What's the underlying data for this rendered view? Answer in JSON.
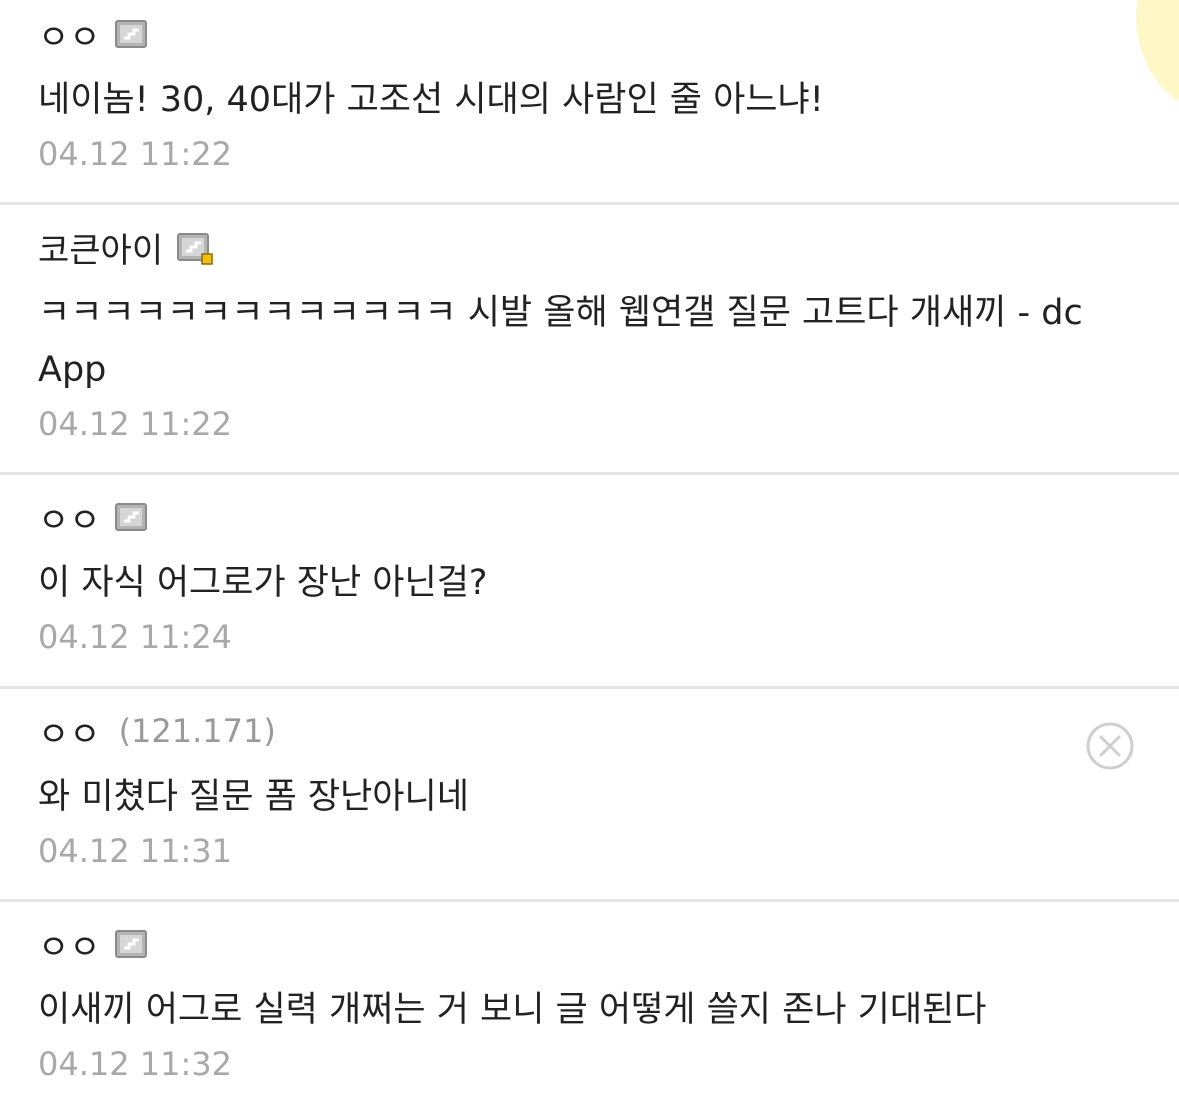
{
  "comments": [
    {
      "author": "ㅇㅇ",
      "badge_icon": "fixed-nick-icon",
      "text": "네이놈! 30, 40대가 고조선 시대의 사람인 줄 아느냐!",
      "time": "04.12 11:22"
    },
    {
      "author": "코큰아이",
      "badge_icon": "fixed-nick-sub-icon",
      "text": "ㅋㅋㅋㅋㅋㅋㅋㅋㅋㅋㅋㅋㅋ 시발 올해 웹연갤 질문 고트다 개새끼 - dc App",
      "time": "04.12 11:22"
    },
    {
      "author": "ㅇㅇ",
      "badge_icon": "fixed-nick-icon",
      "text": "이 자식 어그로가 장난 아닌걸?",
      "time": "04.12 11:24"
    },
    {
      "author": "ㅇㅇ",
      "ip": "(121.171)",
      "delete_icon": "close-circle-icon",
      "text": "와 미쳤다 질문 폼 장난아니네",
      "time": "04.12 11:31"
    },
    {
      "author": "ㅇㅇ",
      "badge_icon": "fixed-nick-icon",
      "text": "이새끼 어그로 실력 개쩌는 거 보니 글 어떻게 쓸지 존나 기대된다",
      "time": "04.12 11:32"
    }
  ],
  "colors": {
    "text": "#222222",
    "timestamp": "#a8a8a8",
    "divider": "#e4e4e4",
    "badge_gray": "#9e9e9e",
    "badge_yellow": "#f2c200"
  }
}
